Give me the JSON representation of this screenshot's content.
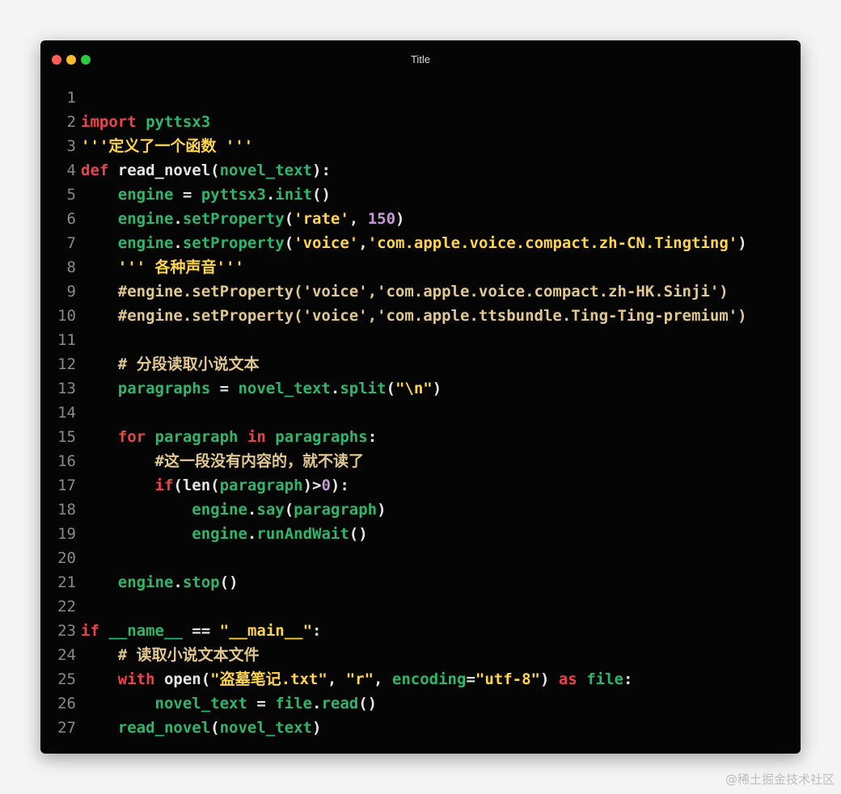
{
  "window": {
    "title": "Title",
    "colors": {
      "background": "#050505",
      "keyword": "#e8454b",
      "identifier": "#2fb56c",
      "string": "#ffd54a",
      "number": "#c59ad6",
      "comment": "#e0c890"
    }
  },
  "code": {
    "lines": [
      {
        "n": "1",
        "tokens": []
      },
      {
        "n": "2",
        "tokens": [
          {
            "t": "import",
            "c": "kw"
          },
          {
            "t": " ",
            "c": "pl"
          },
          {
            "t": "pyttsx3",
            "c": "id"
          }
        ]
      },
      {
        "n": "3",
        "tokens": [
          {
            "t": "'''定义了一个函数 '''",
            "c": "str"
          }
        ]
      },
      {
        "n": "4",
        "tokens": [
          {
            "t": "def",
            "c": "kw"
          },
          {
            "t": " read_novel(",
            "c": "pl"
          },
          {
            "t": "novel_text",
            "c": "id"
          },
          {
            "t": "):",
            "c": "pl"
          }
        ]
      },
      {
        "n": "5",
        "tokens": [
          {
            "t": "    ",
            "c": "pl"
          },
          {
            "t": "engine",
            "c": "id"
          },
          {
            "t": " = ",
            "c": "pl"
          },
          {
            "t": "pyttsx3",
            "c": "id"
          },
          {
            "t": ".",
            "c": "pl"
          },
          {
            "t": "init",
            "c": "id"
          },
          {
            "t": "()",
            "c": "pl"
          }
        ]
      },
      {
        "n": "6",
        "tokens": [
          {
            "t": "    ",
            "c": "pl"
          },
          {
            "t": "engine",
            "c": "id"
          },
          {
            "t": ".",
            "c": "pl"
          },
          {
            "t": "setProperty",
            "c": "id"
          },
          {
            "t": "(",
            "c": "pl"
          },
          {
            "t": "'rate'",
            "c": "str"
          },
          {
            "t": ", ",
            "c": "pl"
          },
          {
            "t": "150",
            "c": "num"
          },
          {
            "t": ")",
            "c": "pl"
          }
        ]
      },
      {
        "n": "7",
        "tokens": [
          {
            "t": "    ",
            "c": "pl"
          },
          {
            "t": "engine",
            "c": "id"
          },
          {
            "t": ".",
            "c": "pl"
          },
          {
            "t": "setProperty",
            "c": "id"
          },
          {
            "t": "(",
            "c": "pl"
          },
          {
            "t": "'voice'",
            "c": "str"
          },
          {
            "t": ",",
            "c": "pl"
          },
          {
            "t": "'com.apple.voice.compact.zh-CN.Tingting'",
            "c": "str"
          },
          {
            "t": ")",
            "c": "pl"
          }
        ]
      },
      {
        "n": "8",
        "tokens": [
          {
            "t": "    ",
            "c": "pl"
          },
          {
            "t": "''' 各种声音'''",
            "c": "str"
          }
        ]
      },
      {
        "n": "9",
        "tokens": [
          {
            "t": "    #engine.setProperty('voice','com.apple.voice.compact.zh-HK.Sinji')",
            "c": "cm"
          }
        ]
      },
      {
        "n": "10",
        "tokens": [
          {
            "t": "    #engine.setProperty('voice','com.apple.ttsbundle.Ting-Ting-premium')",
            "c": "cm"
          }
        ]
      },
      {
        "n": "11",
        "tokens": []
      },
      {
        "n": "12",
        "tokens": [
          {
            "t": "    # 分段读取小说文本",
            "c": "cm"
          }
        ]
      },
      {
        "n": "13",
        "tokens": [
          {
            "t": "    ",
            "c": "pl"
          },
          {
            "t": "paragraphs",
            "c": "id"
          },
          {
            "t": " = ",
            "c": "pl"
          },
          {
            "t": "novel_text",
            "c": "id"
          },
          {
            "t": ".",
            "c": "pl"
          },
          {
            "t": "split",
            "c": "id"
          },
          {
            "t": "(",
            "c": "pl"
          },
          {
            "t": "\"\\n\"",
            "c": "str"
          },
          {
            "t": ")",
            "c": "pl"
          }
        ]
      },
      {
        "n": "14",
        "tokens": []
      },
      {
        "n": "15",
        "tokens": [
          {
            "t": "    ",
            "c": "pl"
          },
          {
            "t": "for",
            "c": "kw"
          },
          {
            "t": " ",
            "c": "pl"
          },
          {
            "t": "paragraph",
            "c": "id"
          },
          {
            "t": " ",
            "c": "pl"
          },
          {
            "t": "in",
            "c": "kw"
          },
          {
            "t": " ",
            "c": "pl"
          },
          {
            "t": "paragraphs",
            "c": "id"
          },
          {
            "t": ":",
            "c": "pl"
          }
        ]
      },
      {
        "n": "16",
        "tokens": [
          {
            "t": "        #这一段没有内容的，就不读了",
            "c": "cm"
          }
        ]
      },
      {
        "n": "17",
        "tokens": [
          {
            "t": "        ",
            "c": "pl"
          },
          {
            "t": "if",
            "c": "kw"
          },
          {
            "t": "(len(",
            "c": "pl"
          },
          {
            "t": "paragraph",
            "c": "id"
          },
          {
            "t": ")>",
            "c": "pl"
          },
          {
            "t": "0",
            "c": "num"
          },
          {
            "t": "):",
            "c": "pl"
          }
        ]
      },
      {
        "n": "18",
        "tokens": [
          {
            "t": "            ",
            "c": "pl"
          },
          {
            "t": "engine",
            "c": "id"
          },
          {
            "t": ".",
            "c": "pl"
          },
          {
            "t": "say",
            "c": "id"
          },
          {
            "t": "(",
            "c": "pl"
          },
          {
            "t": "paragraph",
            "c": "id"
          },
          {
            "t": ")",
            "c": "pl"
          }
        ]
      },
      {
        "n": "19",
        "tokens": [
          {
            "t": "            ",
            "c": "pl"
          },
          {
            "t": "engine",
            "c": "id"
          },
          {
            "t": ".",
            "c": "pl"
          },
          {
            "t": "runAndWait",
            "c": "id"
          },
          {
            "t": "()",
            "c": "pl"
          }
        ]
      },
      {
        "n": "20",
        "tokens": []
      },
      {
        "n": "21",
        "tokens": [
          {
            "t": "    ",
            "c": "pl"
          },
          {
            "t": "engine",
            "c": "id"
          },
          {
            "t": ".",
            "c": "pl"
          },
          {
            "t": "stop",
            "c": "id"
          },
          {
            "t": "()",
            "c": "pl"
          }
        ]
      },
      {
        "n": "22",
        "tokens": []
      },
      {
        "n": "23",
        "tokens": [
          {
            "t": "if",
            "c": "kw"
          },
          {
            "t": " ",
            "c": "pl"
          },
          {
            "t": "__name__",
            "c": "id"
          },
          {
            "t": " == ",
            "c": "pl"
          },
          {
            "t": "\"__main__\"",
            "c": "str"
          },
          {
            "t": ":",
            "c": "pl"
          }
        ]
      },
      {
        "n": "24",
        "tokens": [
          {
            "t": "    # 读取小说文本文件",
            "c": "cm"
          }
        ]
      },
      {
        "n": "25",
        "tokens": [
          {
            "t": "    ",
            "c": "pl"
          },
          {
            "t": "with",
            "c": "kw"
          },
          {
            "t": " open(",
            "c": "pl"
          },
          {
            "t": "\"盗墓笔记.txt\"",
            "c": "str"
          },
          {
            "t": ", ",
            "c": "pl"
          },
          {
            "t": "\"r\"",
            "c": "str"
          },
          {
            "t": ", ",
            "c": "pl"
          },
          {
            "t": "encoding",
            "c": "id"
          },
          {
            "t": "=",
            "c": "pl"
          },
          {
            "t": "\"utf-8\"",
            "c": "str"
          },
          {
            "t": ") ",
            "c": "pl"
          },
          {
            "t": "as",
            "c": "kw"
          },
          {
            "t": " ",
            "c": "pl"
          },
          {
            "t": "file",
            "c": "id"
          },
          {
            "t": ":",
            "c": "pl"
          }
        ]
      },
      {
        "n": "26",
        "tokens": [
          {
            "t": "        ",
            "c": "pl"
          },
          {
            "t": "novel_text",
            "c": "id"
          },
          {
            "t": " = ",
            "c": "pl"
          },
          {
            "t": "file",
            "c": "id"
          },
          {
            "t": ".",
            "c": "pl"
          },
          {
            "t": "read",
            "c": "id"
          },
          {
            "t": "()",
            "c": "pl"
          }
        ]
      },
      {
        "n": "27",
        "tokens": [
          {
            "t": "    ",
            "c": "pl"
          },
          {
            "t": "read_novel",
            "c": "id"
          },
          {
            "t": "(",
            "c": "pl"
          },
          {
            "t": "novel_text",
            "c": "id"
          },
          {
            "t": ")",
            "c": "pl"
          }
        ]
      }
    ]
  },
  "watermark": "@稀土掘金技术社区"
}
